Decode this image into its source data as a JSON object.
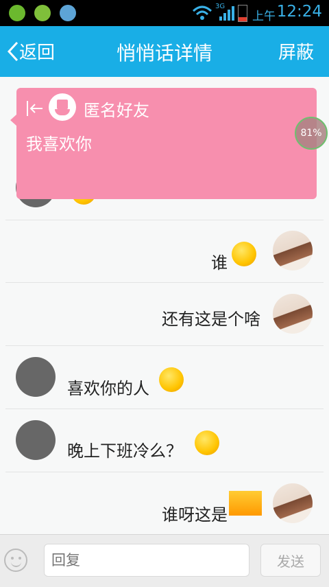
{
  "status_bar": {
    "ampm": "上午",
    "time": "12:24",
    "network": "3G"
  },
  "header": {
    "back_label": "返回",
    "title": "悄悄话详情",
    "right_action": "屏蔽"
  },
  "popup": {
    "sender": "匿名好友",
    "message": "我喜欢你",
    "badge": "81%"
  },
  "messages": [
    {
      "text": "谁"
    },
    {
      "text": "还有这是个啥"
    },
    {
      "text": "喜欢你的人"
    },
    {
      "text": "晚上下班冷么？"
    },
    {
      "text": "谁呀这是"
    }
  ],
  "composer": {
    "placeholder": "回复",
    "send_label": "发送"
  },
  "colors": {
    "header": "#19aee6",
    "popup": "#f78fae"
  }
}
